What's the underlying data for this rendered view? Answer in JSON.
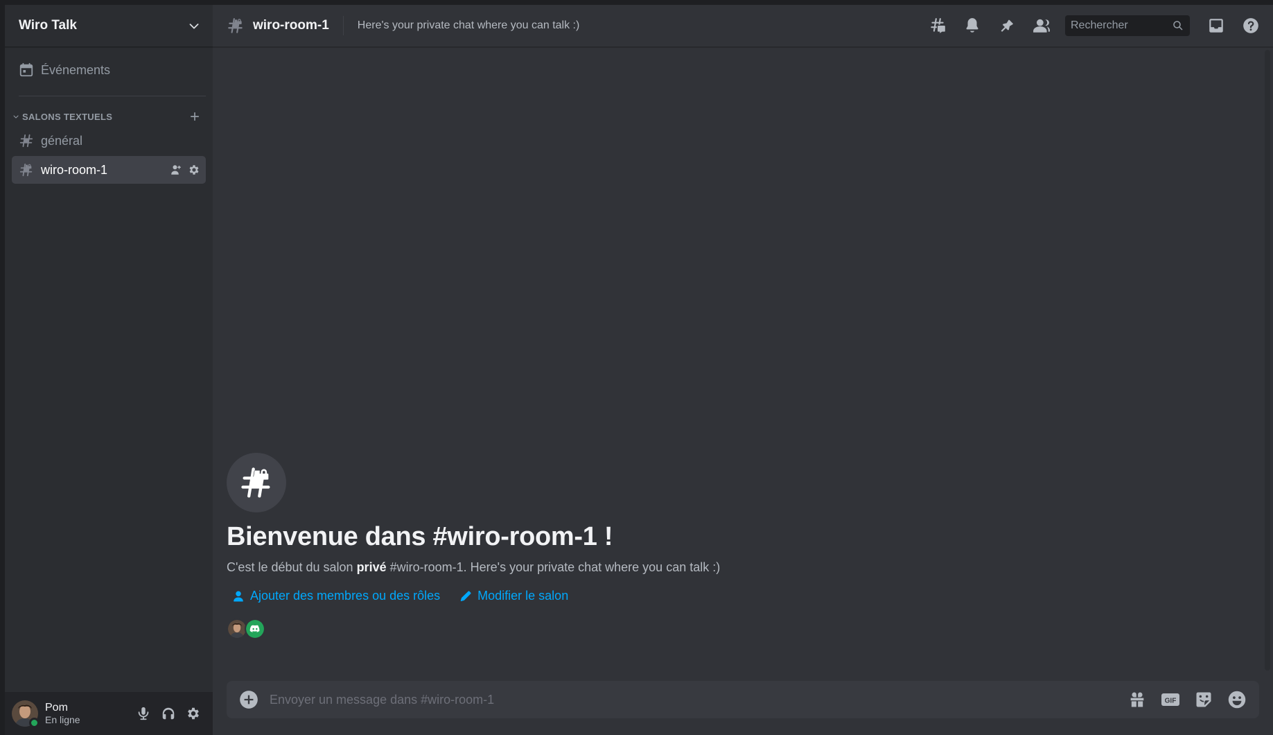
{
  "server": {
    "name": "Wiro Talk"
  },
  "sidebar": {
    "events_label": "Événements",
    "category_label": "SALONS TEXTUELS",
    "channels": [
      {
        "label": "général"
      },
      {
        "label": "wiro-room-1"
      }
    ]
  },
  "user": {
    "name": "Pom",
    "status": "En ligne"
  },
  "header": {
    "channel_name": "wiro-room-1",
    "topic": "Here's your private chat where you can talk :)",
    "search_placeholder": "Rechercher"
  },
  "welcome": {
    "title": "Bienvenue dans #wiro-room-1 !",
    "text_prefix": "C'est le début du salon ",
    "text_bold": "privé",
    "text_suffix": " #wiro-room-1. Here's your private chat where you can talk :)",
    "add_members_label": "Ajouter des membres ou des rôles",
    "edit_channel_label": "Modifier le salon"
  },
  "composer": {
    "placeholder": "Envoyer un message dans #wiro-room-1",
    "gif_label": "GIF"
  },
  "colors": {
    "accent_link": "#00a8fc",
    "online": "#23a55a",
    "discord_green": "#23a55a",
    "background": "#313338",
    "sidebar": "#2b2d31"
  },
  "icons": [
    "calendar-icon",
    "hash-icon",
    "hash-lock-icon",
    "chevron-down-icon",
    "plus-icon",
    "add-member-icon",
    "gear-icon",
    "threads-icon",
    "bell-icon",
    "pin-icon",
    "members-icon",
    "search-icon",
    "inbox-icon",
    "help-icon",
    "mic-icon",
    "headphones-icon",
    "gift-icon",
    "gif-icon",
    "sticker-icon",
    "emoji-icon",
    "pencil-icon",
    "add-circle-icon",
    "discord-icon"
  ]
}
